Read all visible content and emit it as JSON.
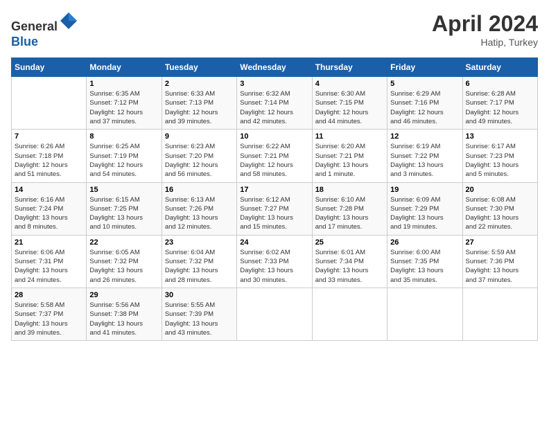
{
  "header": {
    "logo_line1": "General",
    "logo_line2": "Blue",
    "month": "April 2024",
    "location": "Hatip, Turkey"
  },
  "weekdays": [
    "Sunday",
    "Monday",
    "Tuesday",
    "Wednesday",
    "Thursday",
    "Friday",
    "Saturday"
  ],
  "weeks": [
    [
      {
        "day": "",
        "info": ""
      },
      {
        "day": "1",
        "info": "Sunrise: 6:35 AM\nSunset: 7:12 PM\nDaylight: 12 hours\nand 37 minutes."
      },
      {
        "day": "2",
        "info": "Sunrise: 6:33 AM\nSunset: 7:13 PM\nDaylight: 12 hours\nand 39 minutes."
      },
      {
        "day": "3",
        "info": "Sunrise: 6:32 AM\nSunset: 7:14 PM\nDaylight: 12 hours\nand 42 minutes."
      },
      {
        "day": "4",
        "info": "Sunrise: 6:30 AM\nSunset: 7:15 PM\nDaylight: 12 hours\nand 44 minutes."
      },
      {
        "day": "5",
        "info": "Sunrise: 6:29 AM\nSunset: 7:16 PM\nDaylight: 12 hours\nand 46 minutes."
      },
      {
        "day": "6",
        "info": "Sunrise: 6:28 AM\nSunset: 7:17 PM\nDaylight: 12 hours\nand 49 minutes."
      }
    ],
    [
      {
        "day": "7",
        "info": "Sunrise: 6:26 AM\nSunset: 7:18 PM\nDaylight: 12 hours\nand 51 minutes."
      },
      {
        "day": "8",
        "info": "Sunrise: 6:25 AM\nSunset: 7:19 PM\nDaylight: 12 hours\nand 54 minutes."
      },
      {
        "day": "9",
        "info": "Sunrise: 6:23 AM\nSunset: 7:20 PM\nDaylight: 12 hours\nand 56 minutes."
      },
      {
        "day": "10",
        "info": "Sunrise: 6:22 AM\nSunset: 7:21 PM\nDaylight: 12 hours\nand 58 minutes."
      },
      {
        "day": "11",
        "info": "Sunrise: 6:20 AM\nSunset: 7:21 PM\nDaylight: 13 hours\nand 1 minute."
      },
      {
        "day": "12",
        "info": "Sunrise: 6:19 AM\nSunset: 7:22 PM\nDaylight: 13 hours\nand 3 minutes."
      },
      {
        "day": "13",
        "info": "Sunrise: 6:17 AM\nSunset: 7:23 PM\nDaylight: 13 hours\nand 5 minutes."
      }
    ],
    [
      {
        "day": "14",
        "info": "Sunrise: 6:16 AM\nSunset: 7:24 PM\nDaylight: 13 hours\nand 8 minutes."
      },
      {
        "day": "15",
        "info": "Sunrise: 6:15 AM\nSunset: 7:25 PM\nDaylight: 13 hours\nand 10 minutes."
      },
      {
        "day": "16",
        "info": "Sunrise: 6:13 AM\nSunset: 7:26 PM\nDaylight: 13 hours\nand 12 minutes."
      },
      {
        "day": "17",
        "info": "Sunrise: 6:12 AM\nSunset: 7:27 PM\nDaylight: 13 hours\nand 15 minutes."
      },
      {
        "day": "18",
        "info": "Sunrise: 6:10 AM\nSunset: 7:28 PM\nDaylight: 13 hours\nand 17 minutes."
      },
      {
        "day": "19",
        "info": "Sunrise: 6:09 AM\nSunset: 7:29 PM\nDaylight: 13 hours\nand 19 minutes."
      },
      {
        "day": "20",
        "info": "Sunrise: 6:08 AM\nSunset: 7:30 PM\nDaylight: 13 hours\nand 22 minutes."
      }
    ],
    [
      {
        "day": "21",
        "info": "Sunrise: 6:06 AM\nSunset: 7:31 PM\nDaylight: 13 hours\nand 24 minutes."
      },
      {
        "day": "22",
        "info": "Sunrise: 6:05 AM\nSunset: 7:32 PM\nDaylight: 13 hours\nand 26 minutes."
      },
      {
        "day": "23",
        "info": "Sunrise: 6:04 AM\nSunset: 7:32 PM\nDaylight: 13 hours\nand 28 minutes."
      },
      {
        "day": "24",
        "info": "Sunrise: 6:02 AM\nSunset: 7:33 PM\nDaylight: 13 hours\nand 30 minutes."
      },
      {
        "day": "25",
        "info": "Sunrise: 6:01 AM\nSunset: 7:34 PM\nDaylight: 13 hours\nand 33 minutes."
      },
      {
        "day": "26",
        "info": "Sunrise: 6:00 AM\nSunset: 7:35 PM\nDaylight: 13 hours\nand 35 minutes."
      },
      {
        "day": "27",
        "info": "Sunrise: 5:59 AM\nSunset: 7:36 PM\nDaylight: 13 hours\nand 37 minutes."
      }
    ],
    [
      {
        "day": "28",
        "info": "Sunrise: 5:58 AM\nSunset: 7:37 PM\nDaylight: 13 hours\nand 39 minutes."
      },
      {
        "day": "29",
        "info": "Sunrise: 5:56 AM\nSunset: 7:38 PM\nDaylight: 13 hours\nand 41 minutes."
      },
      {
        "day": "30",
        "info": "Sunrise: 5:55 AM\nSunset: 7:39 PM\nDaylight: 13 hours\nand 43 minutes."
      },
      {
        "day": "",
        "info": ""
      },
      {
        "day": "",
        "info": ""
      },
      {
        "day": "",
        "info": ""
      },
      {
        "day": "",
        "info": ""
      }
    ]
  ]
}
